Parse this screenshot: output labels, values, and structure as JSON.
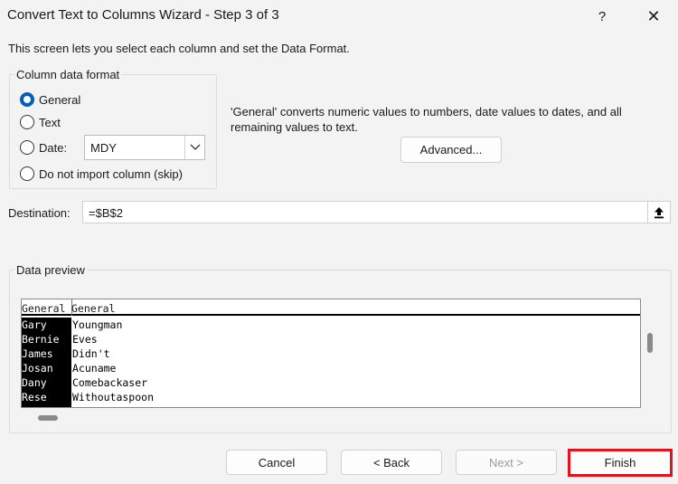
{
  "window": {
    "title": "Convert Text to Columns Wizard - Step 3 of 3",
    "help_icon": "?",
    "close_icon": "✕"
  },
  "intro_text": "This screen lets you select each column and set the Data Format.",
  "column_format": {
    "group_label": "Column data format",
    "options": [
      {
        "label": "General",
        "checked": true
      },
      {
        "label": "Text",
        "checked": false
      },
      {
        "label": "Date:",
        "checked": false
      },
      {
        "label": "Do not import column (skip)",
        "checked": false
      }
    ],
    "date_format_value": "MDY"
  },
  "description": "'General' converts numeric values to numbers, date values to dates, and all remaining values to text.",
  "advanced_label": "Advanced...",
  "destination": {
    "label": "Destination:",
    "value": "=$B$2"
  },
  "data_preview": {
    "group_label": "Data preview",
    "headers": [
      "General",
      "General"
    ],
    "rows": [
      [
        "Gary",
        "Youngman"
      ],
      [
        "Bernie",
        "Eves"
      ],
      [
        "James",
        "Didn't"
      ],
      [
        "Josan",
        "Acuname"
      ],
      [
        "Dany",
        "Comebackaser"
      ],
      [
        "Rese",
        "Withoutaspoon"
      ]
    ]
  },
  "buttons": {
    "cancel": "Cancel",
    "back": "< Back",
    "next": "Next >",
    "finish": "Finish"
  },
  "colors": {
    "background": "#f3f3f3",
    "accent": "#005fb8",
    "highlight": "#e0141e",
    "disabled_text": "#9a9a9a"
  }
}
